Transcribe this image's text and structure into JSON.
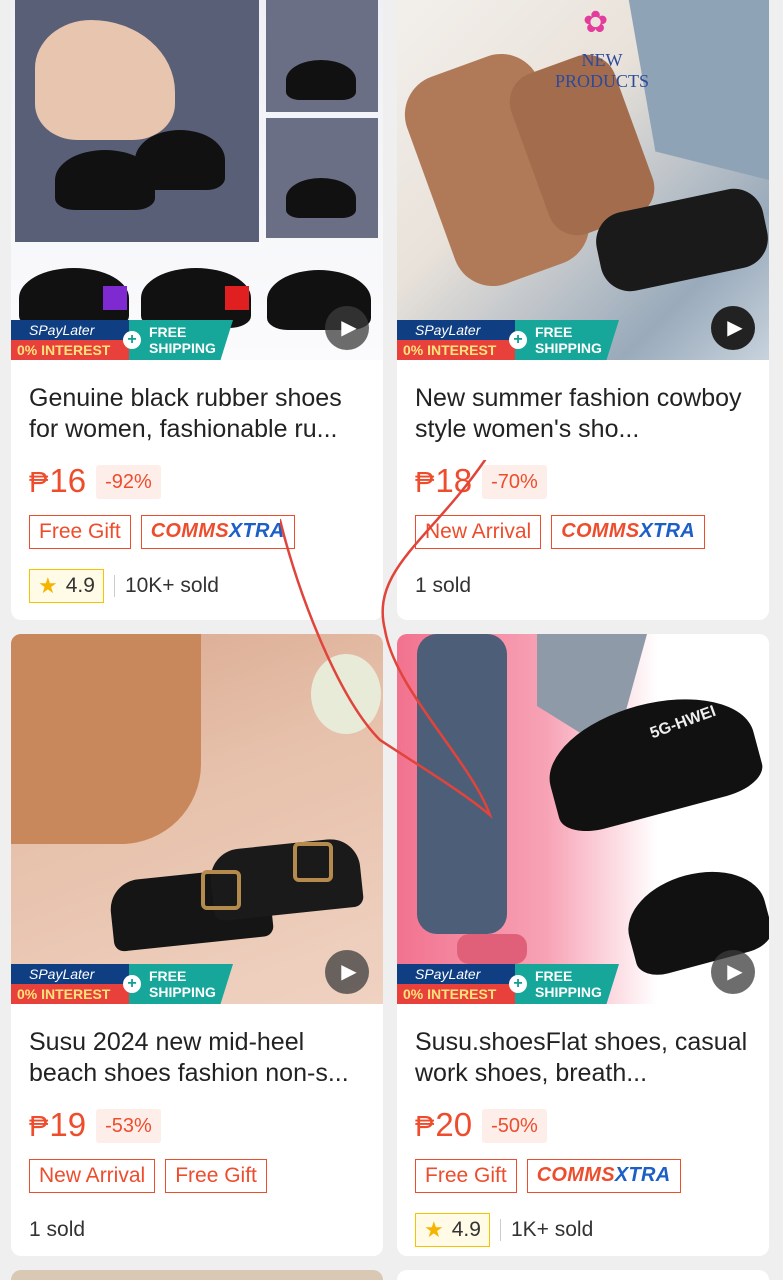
{
  "products": [
    {
      "title": "Genuine black rubber shoes for women, fashionable ru...",
      "currency": "₱",
      "price": "16",
      "discount": "-92%",
      "tags": [
        {
          "label": "Free Gift",
          "type": "plain"
        },
        {
          "label_a": "COMMS",
          "label_b": "XTRA",
          "type": "comms"
        }
      ],
      "rating": "4.9",
      "sold": "10K+ sold",
      "badge": {
        "spay_top": "SPayLater",
        "spay_bottom": "0% INTEREST",
        "free_line1": "FREE",
        "free_line2": "SHIPPING"
      }
    },
    {
      "title": "New summer fashion cowboy style women's sho...",
      "currency": "₱",
      "price": "18",
      "discount": "-70%",
      "tags": [
        {
          "label": "New Arrival",
          "type": "plain"
        },
        {
          "label_a": "COMMS",
          "label_b": "XTRA",
          "type": "comms"
        }
      ],
      "rating": null,
      "sold": "1 sold",
      "image_text": "NEW PRODUCTS",
      "badge": {
        "spay_top": "SPayLater",
        "spay_bottom": "0% INTEREST",
        "free_line1": "FREE",
        "free_line2": "SHIPPING"
      }
    },
    {
      "title": "Susu 2024 new mid-heel beach shoes fashion non-s...",
      "currency": "₱",
      "price": "19",
      "discount": "-53%",
      "tags": [
        {
          "label": "New Arrival",
          "type": "plain"
        },
        {
          "label": "Free Gift",
          "type": "plain"
        }
      ],
      "rating": null,
      "sold": "1 sold",
      "badge": {
        "spay_top": "SPayLater",
        "spay_bottom": "0% INTEREST",
        "free_line1": "FREE",
        "free_line2": "SHIPPING"
      }
    },
    {
      "title": "Susu.shoesFlat shoes, casual work shoes, breath...",
      "currency": "₱",
      "price": "20",
      "discount": "-50%",
      "tags": [
        {
          "label": "Free Gift",
          "type": "plain"
        },
        {
          "label_a": "COMMS",
          "label_b": "XTRA",
          "type": "comms"
        }
      ],
      "rating": "4.9",
      "sold": "1K+ sold",
      "image_text": "5G-HWEI",
      "badge": {
        "spay_top": "SPayLater",
        "spay_bottom": "0% INTEREST",
        "free_line1": "FREE",
        "free_line2": "SHIPPING"
      }
    }
  ],
  "colors": {
    "accent": "#ee4d2d",
    "spay_blue": "#0f3f82",
    "free_ship": "#16a79a",
    "star": "#f5b400"
  },
  "icons": {
    "play": "play-icon",
    "star": "star-icon"
  }
}
